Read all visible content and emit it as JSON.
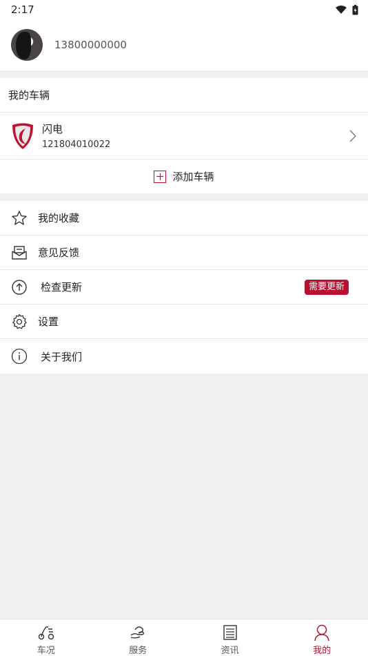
{
  "status_bar": {
    "time": "2:17",
    "icons": [
      "wifi-icon",
      "battery-icon"
    ]
  },
  "profile": {
    "phone": "13800000000"
  },
  "vehicles": {
    "section_title": "我的车辆",
    "items": [
      {
        "name": "闪电",
        "id": "121804010022"
      }
    ],
    "add_label": "添加车辆"
  },
  "menu": {
    "items": [
      {
        "label": "我的收藏",
        "icon": "star-icon"
      },
      {
        "label": "意见反馈",
        "icon": "feedback-mail-icon"
      },
      {
        "label": "检查更新",
        "icon": "upload-arrow-icon",
        "badge": "需要更新"
      },
      {
        "label": "设置",
        "icon": "gear-icon"
      },
      {
        "label": "关于我们",
        "icon": "info-icon"
      }
    ]
  },
  "tab_bar": {
    "tabs": [
      {
        "label": "车况",
        "icon": "scooter-icon"
      },
      {
        "label": "服务",
        "icon": "hand-service-icon"
      },
      {
        "label": "资讯",
        "icon": "news-list-icon"
      },
      {
        "label": "我的",
        "icon": "person-icon",
        "active": true
      }
    ]
  },
  "colors": {
    "accent": "#b8102e",
    "background": "#f0f0f0"
  }
}
